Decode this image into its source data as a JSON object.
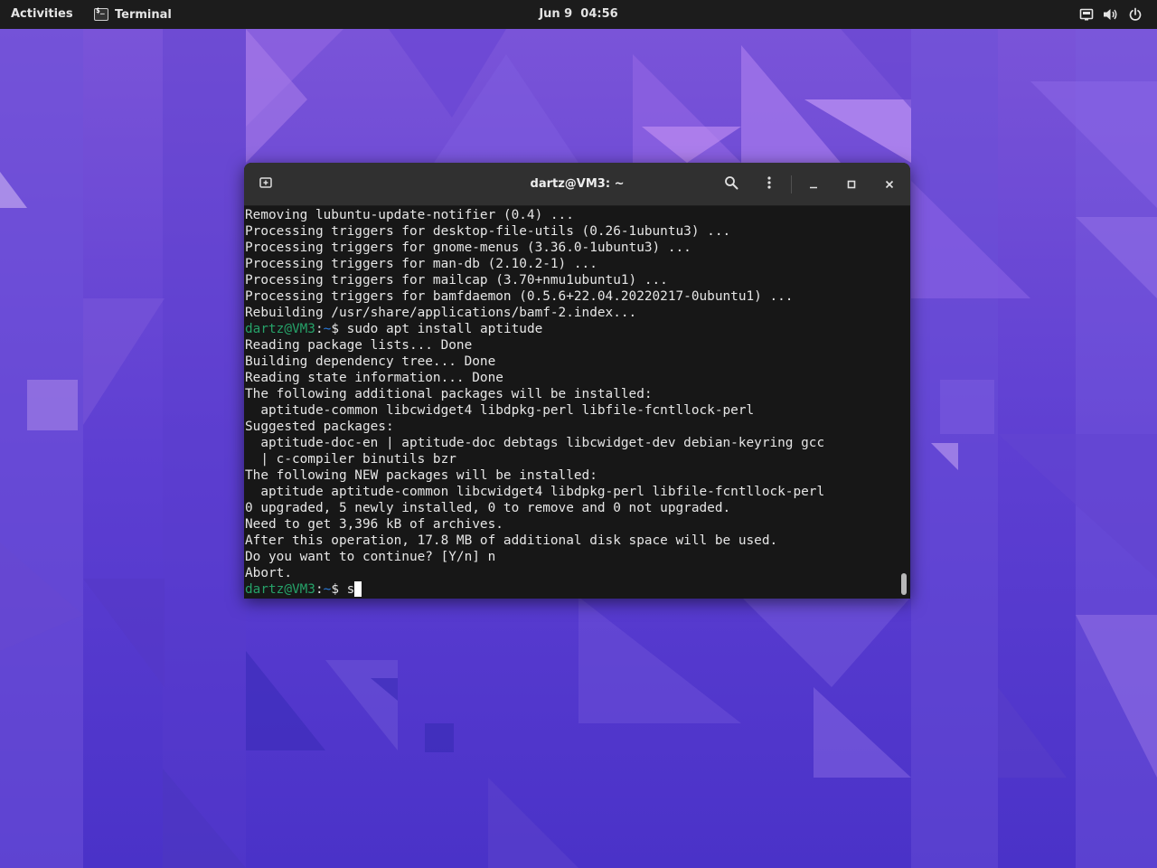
{
  "topbar": {
    "activities": "Activities",
    "app_name": "Terminal",
    "clock": "Jun 9  04:56",
    "tray": [
      "network-icon",
      "volume-icon",
      "power-icon"
    ]
  },
  "terminal": {
    "title": "dartz@VM3: ~",
    "prompt": {
      "user": "dartz@VM3",
      "separator": ":",
      "path": "~",
      "symbol": "$"
    },
    "lines": [
      {
        "type": "output",
        "text": "Removing lubuntu-update-notifier (0.4) ..."
      },
      {
        "type": "output",
        "text": "Processing triggers for desktop-file-utils (0.26-1ubuntu3) ..."
      },
      {
        "type": "output",
        "text": "Processing triggers for gnome-menus (3.36.0-1ubuntu3) ..."
      },
      {
        "type": "output",
        "text": "Processing triggers for man-db (2.10.2-1) ..."
      },
      {
        "type": "output",
        "text": "Processing triggers for mailcap (3.70+nmu1ubuntu1) ..."
      },
      {
        "type": "output",
        "text": "Processing triggers for bamfdaemon (0.5.6+22.04.20220217-0ubuntu1) ..."
      },
      {
        "type": "output",
        "text": "Rebuilding /usr/share/applications/bamf-2.index..."
      },
      {
        "type": "prompt",
        "text": "sudo apt install aptitude"
      },
      {
        "type": "output",
        "text": "Reading package lists... Done"
      },
      {
        "type": "output",
        "text": "Building dependency tree... Done"
      },
      {
        "type": "output",
        "text": "Reading state information... Done"
      },
      {
        "type": "output",
        "text": "The following additional packages will be installed:"
      },
      {
        "type": "output",
        "text": "  aptitude-common libcwidget4 libdpkg-perl libfile-fcntllock-perl"
      },
      {
        "type": "output",
        "text": "Suggested packages:"
      },
      {
        "type": "output",
        "text": "  aptitude-doc-en | aptitude-doc debtags libcwidget-dev debian-keyring gcc"
      },
      {
        "type": "output",
        "text": "  | c-compiler binutils bzr"
      },
      {
        "type": "output",
        "text": "The following NEW packages will be installed:"
      },
      {
        "type": "output",
        "text": "  aptitude aptitude-common libcwidget4 libdpkg-perl libfile-fcntllock-perl"
      },
      {
        "type": "output",
        "text": "0 upgraded, 5 newly installed, 0 to remove and 0 not upgraded."
      },
      {
        "type": "output",
        "text": "Need to get 3,396 kB of archives."
      },
      {
        "type": "output",
        "text": "After this operation, 17.8 MB of additional disk space will be used."
      },
      {
        "type": "output",
        "text": "Do you want to continue? [Y/n] n"
      },
      {
        "type": "output",
        "text": "Abort."
      },
      {
        "type": "prompt_active",
        "text": "s"
      }
    ]
  },
  "colors": {
    "prompt_user": "#26a269",
    "prompt_path": "#2a7bde",
    "terminal_bg": "#171717",
    "headerbar_bg": "#303030",
    "topbar_bg": "#1c1c1c"
  }
}
